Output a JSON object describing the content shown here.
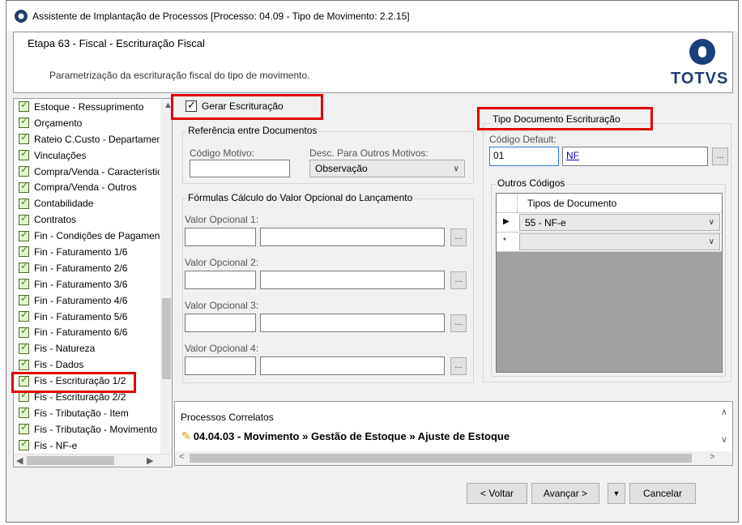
{
  "window": {
    "title": "Assistente de Implantação de Processos [Processo: 04.09 - Tipo de Movimento: 2.2.15]"
  },
  "header": {
    "step_title": "Etapa 63 - Fiscal - Escrituração Fiscal",
    "step_subtitle": "Parametrização da escrituração fiscal do tipo de movimento.",
    "logo_text": "TOTVS"
  },
  "sidebar": {
    "items": [
      {
        "label": "Estoque - Ressuprimento"
      },
      {
        "label": "Orçamento"
      },
      {
        "label": "Rateio C.Custo - Departamento"
      },
      {
        "label": "Vinculações"
      },
      {
        "label": "Compra/Venda - Características"
      },
      {
        "label": "Compra/Venda - Outros"
      },
      {
        "label": "Contabilidade"
      },
      {
        "label": "Contratos"
      },
      {
        "label": "Fin - Condições de Pagamento"
      },
      {
        "label": "Fin - Faturamento 1/6"
      },
      {
        "label": "Fin - Faturamento 2/6"
      },
      {
        "label": "Fin - Faturamento 3/6"
      },
      {
        "label": "Fin - Faturamento 4/6"
      },
      {
        "label": "Fin - Faturamento 5/6"
      },
      {
        "label": "Fin - Faturamento 6/6"
      },
      {
        "label": "Fis - Natureza"
      },
      {
        "label": "Fis - Dados"
      },
      {
        "label": "Fis - Escrituração 1/2"
      },
      {
        "label": "Fis - Escrituração 2/2"
      },
      {
        "label": "Fis - Tributação - Item"
      },
      {
        "label": "Fis - Tributação - Movimento"
      },
      {
        "label": "Fis - NF-e"
      }
    ],
    "selected_index": 17
  },
  "form": {
    "gerar_escrituracao_label": "Gerar Escrituração",
    "gerar_escrituracao_checked": true,
    "ref_group_label": "Referência entre Documentos",
    "codigo_motivo_label": "Código Motivo:",
    "codigo_motivo_value": "",
    "desc_outros_label": "Desc. Para Outros Motivos:",
    "desc_outros_value": "Observação",
    "formulas_group_label": "Fórmulas Cálculo do Valor Opcional do Lançamento",
    "valores": [
      {
        "label": "Valor Opcional 1:"
      },
      {
        "label": "Valor Opcional 2:"
      },
      {
        "label": "Valor Opcional 3:"
      },
      {
        "label": "Valor Opcional 4:"
      }
    ],
    "ellipsis": "..."
  },
  "tipo_doc": {
    "group_label": "Tipo Documento Escrituração",
    "codigo_default_label": "Código Default:",
    "codigo_default_value": "01",
    "codigo_default_desc": "NF",
    "outros_codigos_label": "Outros Códigos",
    "grid_header": "Tipos de Documento",
    "rows": [
      {
        "marker": "▶",
        "value": "55 - NF-e"
      },
      {
        "marker": "*",
        "value": ""
      }
    ]
  },
  "correlatos": {
    "title": "Processos Correlatos",
    "item": "04.04.03 - Movimento » Gestão de Estoque » Ajuste de Estoque"
  },
  "footer": {
    "voltar": "< Voltar",
    "avancar": "Avançar >",
    "cancelar": "Cancelar"
  }
}
